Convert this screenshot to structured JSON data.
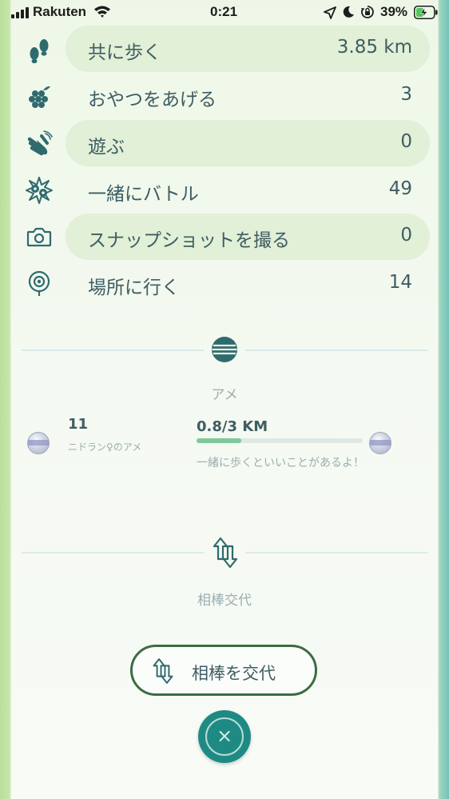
{
  "status_bar": {
    "carrier": "Rakuten",
    "time": "0:21",
    "battery_percent": "39%"
  },
  "buddy_stats": [
    {
      "label": "共に歩く",
      "value": "3.85 km",
      "icon": "footprints-icon",
      "highlighted": true
    },
    {
      "label": "おやつをあげる",
      "value": "3",
      "icon": "berry-icon",
      "highlighted": false
    },
    {
      "label": "遊ぶ",
      "value": "0",
      "icon": "waving-hand-icon",
      "highlighted": true
    },
    {
      "label": "一緒にバトル",
      "value": "49",
      "icon": "battle-icon",
      "highlighted": false
    },
    {
      "label": "スナップショットを撮る",
      "value": "0",
      "icon": "camera-icon",
      "highlighted": true
    },
    {
      "label": "場所に行く",
      "value": "14",
      "icon": "location-pin-icon",
      "highlighted": false
    }
  ],
  "candy": {
    "section_title": "アメ",
    "count": "11",
    "name": "ニドラン♀のアメ",
    "distance": "0.8/3 KM",
    "progress_fraction": 0.267,
    "hint": "一緒に歩くといいことがあるよ！"
  },
  "buddy_swap": {
    "section_title": "相棒交代",
    "button_label": "相棒を交代"
  },
  "close": {
    "symbol": "×",
    "icon": "close-icon"
  },
  "colors": {
    "primary_text": "#3f5d63",
    "secondary_text": "#9aaeb0",
    "highlight_row": "#e1f0d6",
    "progress_fill": "#7fc79a",
    "close_button": "#1f8a83",
    "swap_button_border": "#3c6c44"
  }
}
